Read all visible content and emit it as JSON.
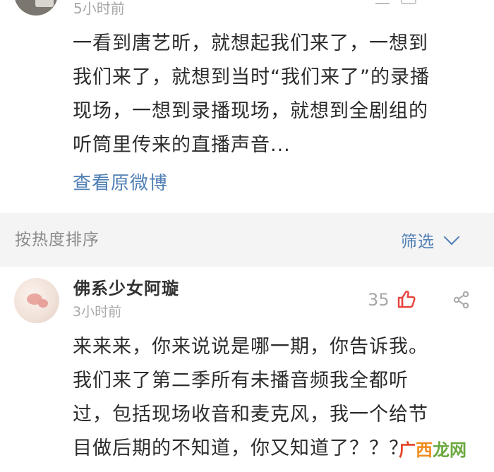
{
  "post": {
    "time": "5小时前",
    "text_lines": [
      "一看到唐艺昕，就想起我们来了，一想到",
      "我们来了，就想到当时“我们来了”的录播",
      "现场，一想到录播现场，就想到全剧组的",
      "听筒里传来的直播声音..."
    ],
    "view_original": "查看原微博"
  },
  "sortbar": {
    "sort_label": "按热度排序",
    "filter_label": "筛选"
  },
  "comment": {
    "username": "佛系少女阿璇",
    "time": "3小时前",
    "like_count": "35",
    "text_lines": [
      "来来来，你来说说是哪一期，你告诉我。",
      "我们来了第二季所有未播音频我全都听",
      "过，包括现场收音和麦克风，我一个给节",
      "目做后期的不知道，你又知道了？？？"
    ]
  },
  "watermark": {
    "text_1": "广",
    "text_2": "西",
    "text_3": "龙网"
  },
  "colors": {
    "link_blue": "#4f7fb5",
    "like_red": "#e8433e",
    "gray_text": "#a8a8a8",
    "sortbar_bg": "#f4f4f5"
  },
  "icons": {
    "like": "thumbs-up-icon",
    "share": "share-icon",
    "filter_chevron": "chevron-down-icon"
  }
}
